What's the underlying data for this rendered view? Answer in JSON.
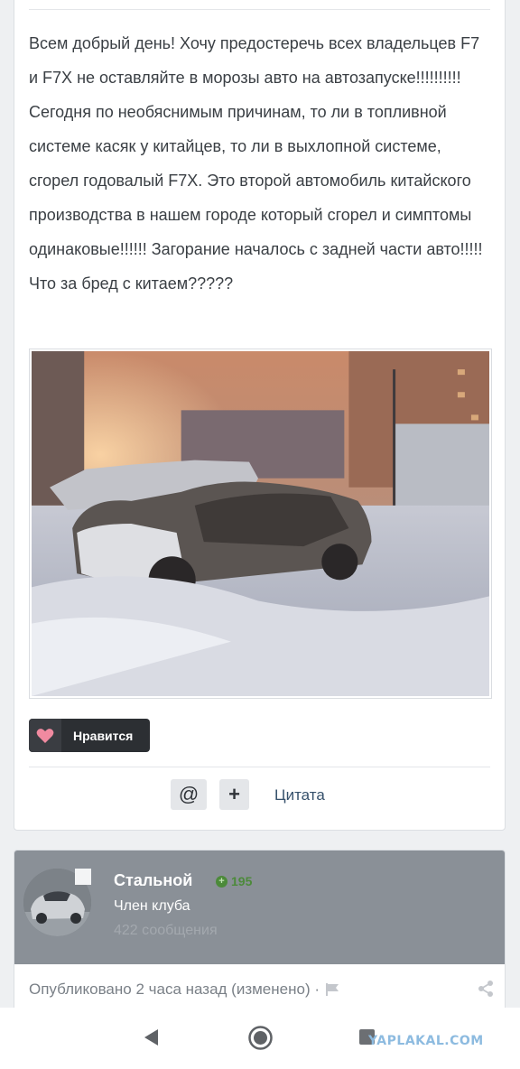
{
  "post": {
    "text": "Всем добрый день! Хочу предостеречь всех владельцев F7 и F7X не оставляйте в морозы авто на автозапуске!!!!!!!!!! Сегодня по необяснимым причинам, то ли в топливной системе касяк у китайцев, то ли в выхлопной системе, сгорел годовалый F7X. Это второй автомобиль китайского производства в нашем городе который сгорел и симптомы одинаковые!!!!!!  Загорание началось с задней части авто!!!!! Что за бред с китаем?????",
    "like_label": "Нравится",
    "actions": {
      "mention_icon": "@",
      "plus_icon": "+",
      "quote_label": "Цитата"
    }
  },
  "author": {
    "name": "Стальной",
    "reputation": "195",
    "rank": "Член клуба",
    "posts": "422 сообщения"
  },
  "meta": {
    "published": "Опубликовано 2 часа назад (изменено) ·"
  },
  "navbar": {
    "watermark": "YAPLAKAL.COM"
  },
  "colors": {
    "accent_dark": "#2c2f33",
    "heart": "#f08aa0",
    "author_header": "#8a9097",
    "reputation": "#4c8a3a",
    "link": "#35506b"
  }
}
